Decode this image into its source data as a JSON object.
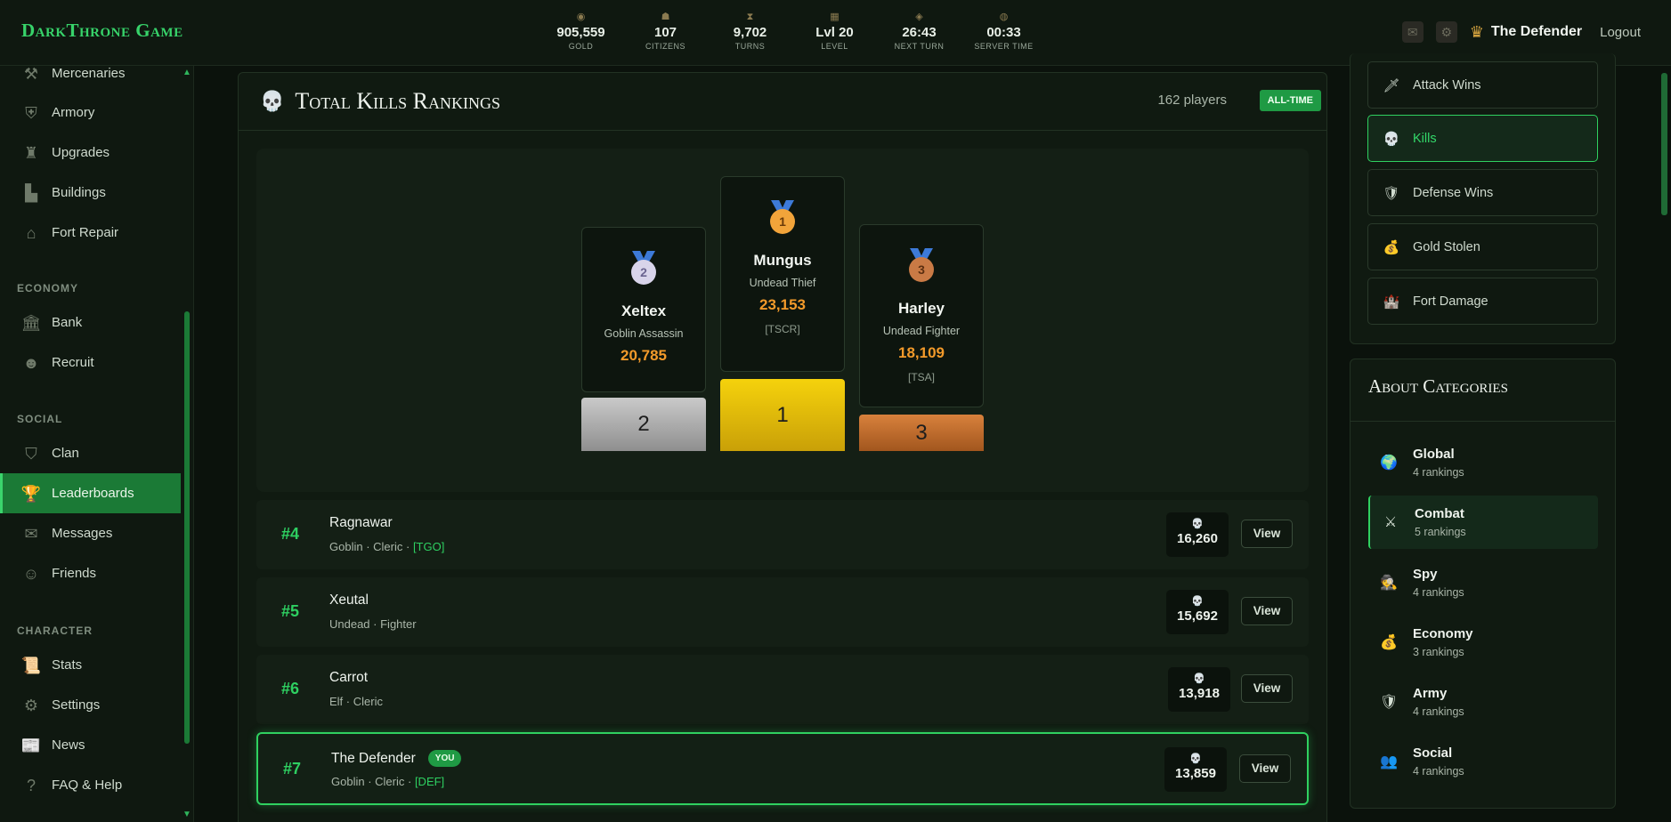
{
  "brand": "DarkThrone Game",
  "stats": [
    {
      "icon": "gold-icon",
      "value": "905,559",
      "label": "GOLD"
    },
    {
      "icon": "citizens-icon",
      "value": "107",
      "label": "CITIZENS"
    },
    {
      "icon": "turns-icon",
      "value": "9,702",
      "label": "TURNS"
    },
    {
      "icon": "level-icon",
      "value": "Lvl 20",
      "label": "LEVEL"
    },
    {
      "icon": "next-turn-icon",
      "value": "26:43",
      "label": "NEXT TURN"
    },
    {
      "icon": "server-time-icon",
      "value": "00:33",
      "label": "SERVER TIME"
    }
  ],
  "user": {
    "name": "The Defender",
    "logout": "Logout"
  },
  "sidebar": {
    "items_top": [
      "Mercenaries",
      "Armory",
      "Upgrades",
      "Buildings",
      "Fort Repair"
    ],
    "economy_heading": "ECONOMY",
    "economy": [
      "Bank",
      "Recruit"
    ],
    "social_heading": "SOCIAL",
    "social": [
      "Clan",
      "Leaderboards",
      "Messages",
      "Friends"
    ],
    "character_heading": "CHARACTER",
    "character": [
      "Stats",
      "Settings",
      "News",
      "FAQ & Help"
    ]
  },
  "panel": {
    "title": "Total Kills Rankings",
    "players": "162 players",
    "period": "ALL-TIME"
  },
  "podium": [
    {
      "place": "2",
      "name": "Xeltex",
      "race_class": "Goblin Assassin",
      "kills": "20,785",
      "clan": ""
    },
    {
      "place": "1",
      "name": "Mungus",
      "race_class": "Undead Thief",
      "kills": "23,153",
      "clan": "[TSCR]"
    },
    {
      "place": "3",
      "name": "Harley",
      "race_class": "Undead Fighter",
      "kills": "18,109",
      "clan": "[TSA]"
    }
  ],
  "rows": [
    {
      "rank": "#4",
      "name": "Ragnawar",
      "race": "Goblin",
      "cls": "Cleric",
      "clan": "[TGO]",
      "kills": "16,260",
      "view": "View"
    },
    {
      "rank": "#5",
      "name": "Xeutal",
      "race": "Undead",
      "cls": "Fighter",
      "clan": "",
      "kills": "15,692",
      "view": "View"
    },
    {
      "rank": "#6",
      "name": "Carrot",
      "race": "Elf",
      "cls": "Cleric",
      "clan": "",
      "kills": "13,918",
      "view": "View"
    },
    {
      "rank": "#7",
      "name": "The Defender",
      "race": "Goblin",
      "cls": "Cleric",
      "clan": "[DEF]",
      "kills": "13,859",
      "view": "View",
      "you": "YOU"
    }
  ],
  "categories": [
    {
      "icon": "sword-icon",
      "glyph": "🗡",
      "label": "Attack Wins"
    },
    {
      "icon": "skull-icon",
      "glyph": "💀",
      "label": "Kills"
    },
    {
      "icon": "shield-icon",
      "glyph": "🛡",
      "label": "Defense Wins"
    },
    {
      "icon": "money-bag-icon",
      "glyph": "💰",
      "label": "Gold Stolen"
    },
    {
      "icon": "castle-icon",
      "glyph": "🏰",
      "label": "Fort Damage"
    }
  ],
  "about": {
    "title": "About Categories",
    "items": [
      {
        "icon": "globe-icon",
        "glyph": "🌍",
        "name": "Global",
        "count": "4 rankings"
      },
      {
        "icon": "crossed-swords-icon",
        "glyph": "⚔",
        "name": "Combat",
        "count": "5 rankings"
      },
      {
        "icon": "spy-icon",
        "glyph": "🕵",
        "name": "Spy",
        "count": "4 rankings"
      },
      {
        "icon": "money-bag-icon",
        "glyph": "💰",
        "name": "Economy",
        "count": "3 rankings"
      },
      {
        "icon": "shield-icon",
        "glyph": "🛡",
        "name": "Army",
        "count": "4 rankings"
      },
      {
        "icon": "people-icon",
        "glyph": "👥",
        "name": "Social",
        "count": "4 rankings"
      }
    ]
  },
  "colors": {
    "accent": "#2ecf61",
    "gold": "#f39a2a",
    "background": "#0b120c"
  }
}
